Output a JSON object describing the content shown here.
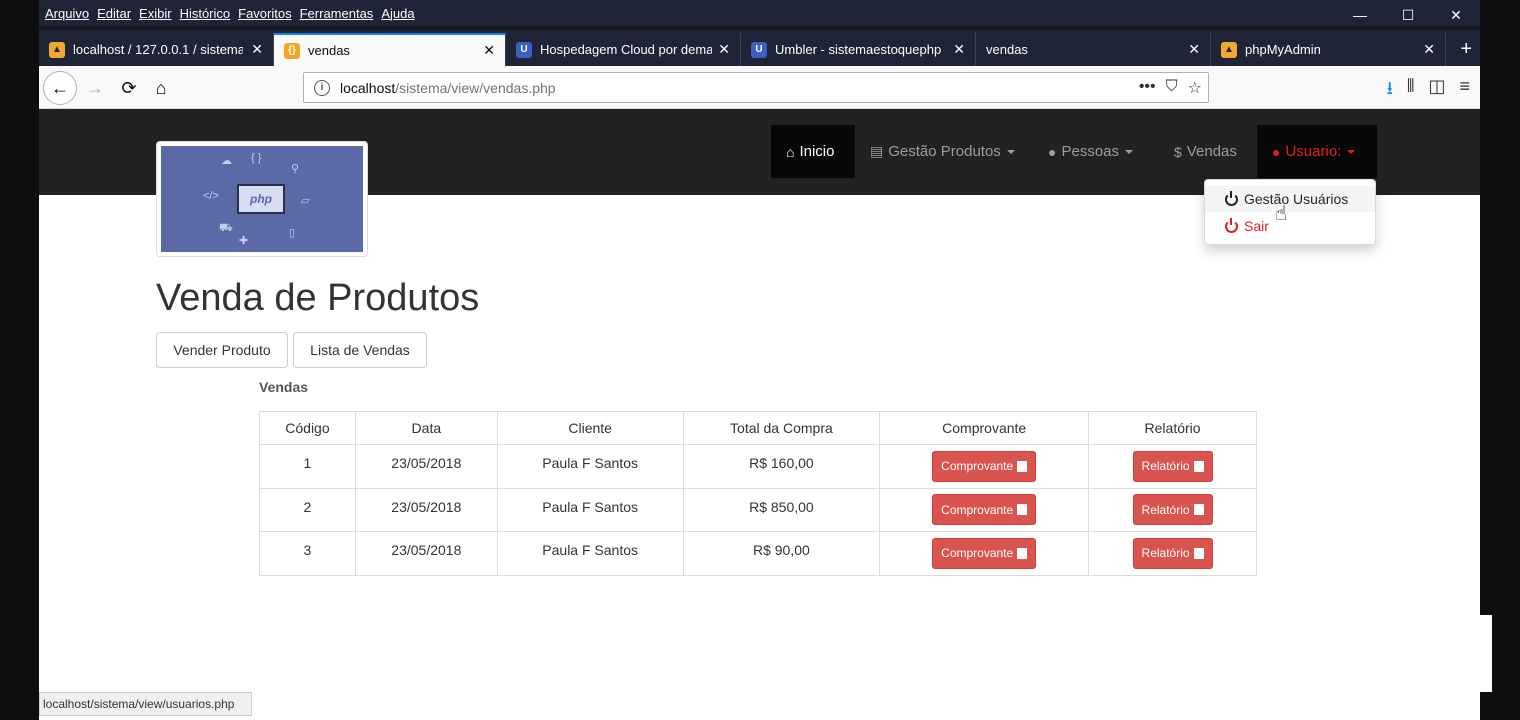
{
  "menu": [
    "Arquivo",
    "Editar",
    "Exibir",
    "Histórico",
    "Favoritos",
    "Ferramentas",
    "Ajuda"
  ],
  "window_controls": {
    "minimize": "—",
    "maximize": "☐",
    "close": "✕"
  },
  "tabs": [
    {
      "label": "localhost / 127.0.0.1 / sistema",
      "close": "✕",
      "icon": "phpmyadmin-icon"
    },
    {
      "label": "vendas",
      "close": "✕",
      "icon": "bracket-icon",
      "active": true
    },
    {
      "label": "Hospedagem Cloud por dema",
      "close": "✕",
      "icon": "umbler-icon"
    },
    {
      "label": "Umbler - sistemaestoquephp",
      "close": "✕",
      "icon": "umbler-icon"
    },
    {
      "label": "vendas",
      "close": "✕"
    },
    {
      "label": "phpMyAdmin",
      "close": "✕",
      "icon": "phpmyadmin-icon"
    }
  ],
  "newtab": "+",
  "navigation": {
    "back": "←",
    "forward": "→",
    "reload": "⟳",
    "home": "⌂"
  },
  "url": {
    "host": "localhost",
    "path": "/sistema/view/vendas.php"
  },
  "url_icons": {
    "more": "•••",
    "pocket": "⛉",
    "star": "☆"
  },
  "toolbar_icons": {
    "download": "⭳",
    "library": "⫴",
    "sidebar": "◫",
    "menu": "≡"
  },
  "logo_text": "php",
  "site_nav": {
    "inicio": "Inicio",
    "gestao_produtos": "Gestão Produtos",
    "pessoas": "Pessoas",
    "vendas": "Vendas",
    "vendas_symbol": "$",
    "usuario": "Usuario:"
  },
  "dropdown": {
    "gestao_usuarios": "Gestão Usuários",
    "sair": "Sair"
  },
  "page_title": "Venda de Produtos",
  "buttons": {
    "vender": "Vender Produto",
    "lista": "Lista de Vendas"
  },
  "section_label": "Vendas",
  "table": {
    "headers": [
      "Código",
      "Data",
      "Cliente",
      "Total da Compra",
      "Comprovante",
      "Relatório"
    ],
    "rows": [
      {
        "codigo": "1",
        "data": "23/05/2018",
        "cliente": "Paula F Santos",
        "total": "R$ 160,00",
        "comprovante": "Comprovante",
        "relatorio": "Relatório"
      },
      {
        "codigo": "2",
        "data": "23/05/2018",
        "cliente": "Paula F Santos",
        "total": "R$ 850,00",
        "comprovante": "Comprovante",
        "relatorio": "Relatório"
      },
      {
        "codigo": "3",
        "data": "23/05/2018",
        "cliente": "Paula F Santos",
        "total": "R$ 90,00",
        "comprovante": "Comprovante",
        "relatorio": "Relatório"
      }
    ]
  },
  "status_url": "localhost/sistema/view/usuarios.php",
  "colors": {
    "accent": "#0a84ff",
    "danger": "#d9534f",
    "navbar": "#222222",
    "user_red": "#e02020"
  }
}
